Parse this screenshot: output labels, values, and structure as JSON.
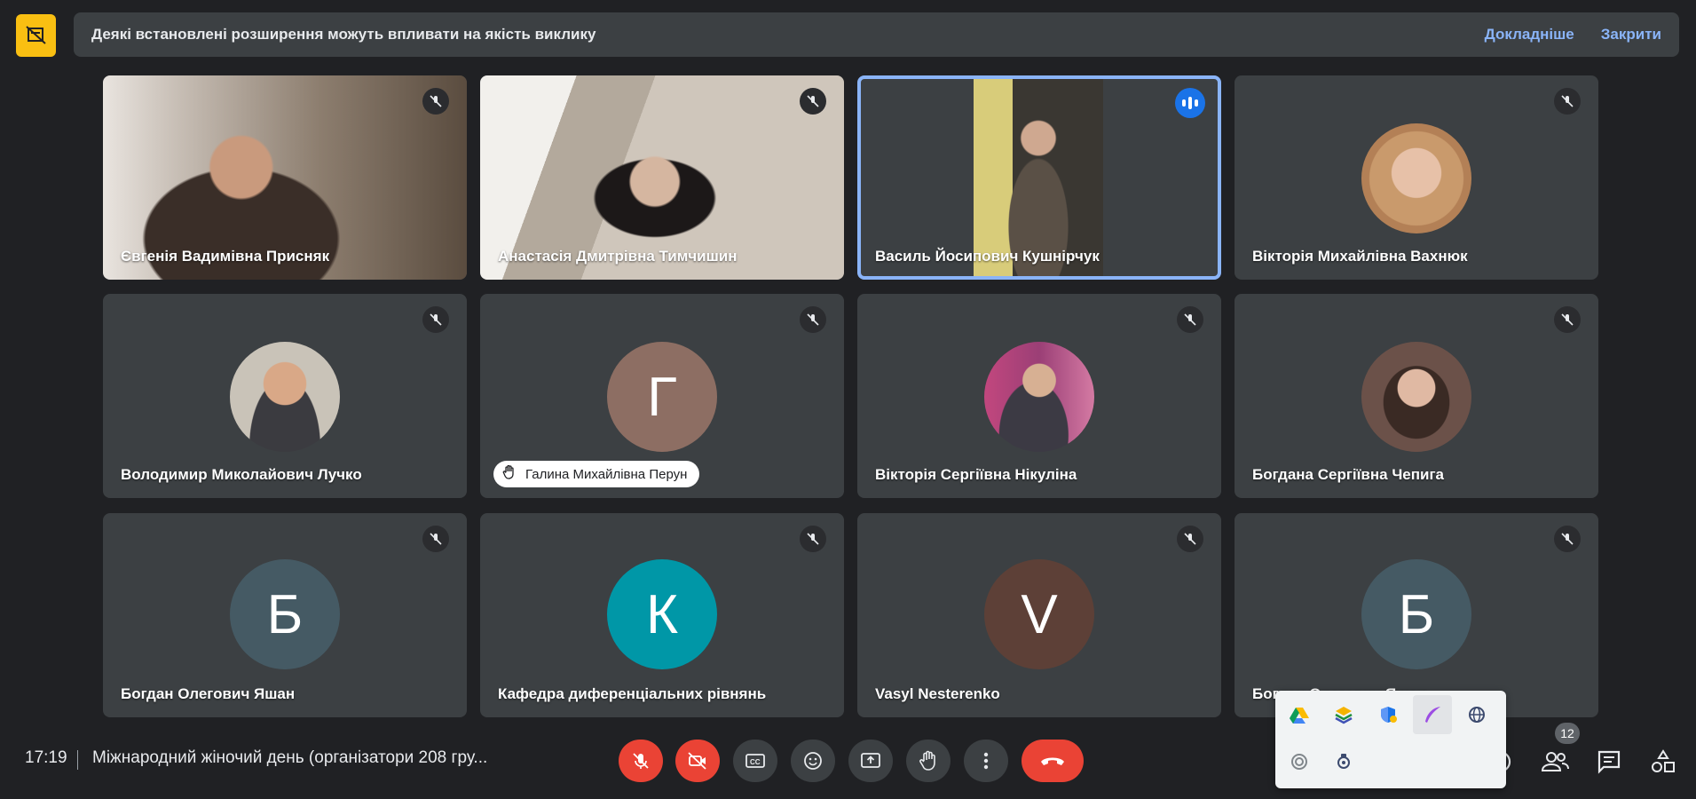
{
  "banner": {
    "message": "Деякі встановлені розширення можуть впливати на якість виклику",
    "learn_more": "Докладніше",
    "close": "Закрити"
  },
  "participants": [
    {
      "name": "Євгенія Вадимівна Присняк",
      "type": "video",
      "muted": true
    },
    {
      "name": "Анастасія Дмитрівна Тимчишин",
      "type": "video",
      "muted": true
    },
    {
      "name": "Василь Йосипович Кушнірчук",
      "type": "video",
      "speaking": true
    },
    {
      "name": "Вікторія Михайлівна Вахнюк",
      "type": "photo",
      "muted": true
    },
    {
      "name": "Володимир Миколайович Лучко",
      "type": "photo",
      "muted": true
    },
    {
      "name": "Галина Михайлівна Перун",
      "type": "initial",
      "initial": "Г",
      "color": "#8d6e63",
      "hand_raised": true,
      "muted": true
    },
    {
      "name": "Вікторія Сергіївна Нікуліна",
      "type": "photo",
      "muted": true
    },
    {
      "name": "Богдана Сергіївна Чепига",
      "type": "photo",
      "muted": true
    },
    {
      "name": "Богдан Олегович Яшан",
      "type": "initial",
      "initial": "Б",
      "color": "#455a64",
      "muted": true
    },
    {
      "name": "Кафедра диференціальних рівнянь",
      "type": "initial",
      "initial": "К",
      "color": "#0097a7",
      "muted": true
    },
    {
      "name": "Vasyl Nesterenko",
      "type": "initial",
      "initial": "V",
      "color": "#5d4037",
      "muted": true
    },
    {
      "name": "Богдан Олегович Яшан",
      "type": "initial",
      "initial": "Б",
      "color": "#455a64",
      "muted": true
    }
  ],
  "footer": {
    "time": "17:19",
    "meeting_title": "Міжнародний жіночий день (організатори 208 гру...",
    "participant_count": "12"
  },
  "controls": [
    "mic-off-icon",
    "camera-off-icon",
    "captions-icon",
    "emoji-icon",
    "present-icon",
    "raise-hand-icon",
    "more-icon",
    "hang-up-icon"
  ],
  "tray_icons": [
    "drive-icon",
    "layers-icon",
    "shield-icon",
    "feather-icon",
    "globe-icon",
    "record-icon",
    "extension-icon"
  ],
  "colors": {
    "accent": "#8ab4f8",
    "danger": "#ea4335",
    "tile": "#3c4043",
    "background": "#202124"
  }
}
